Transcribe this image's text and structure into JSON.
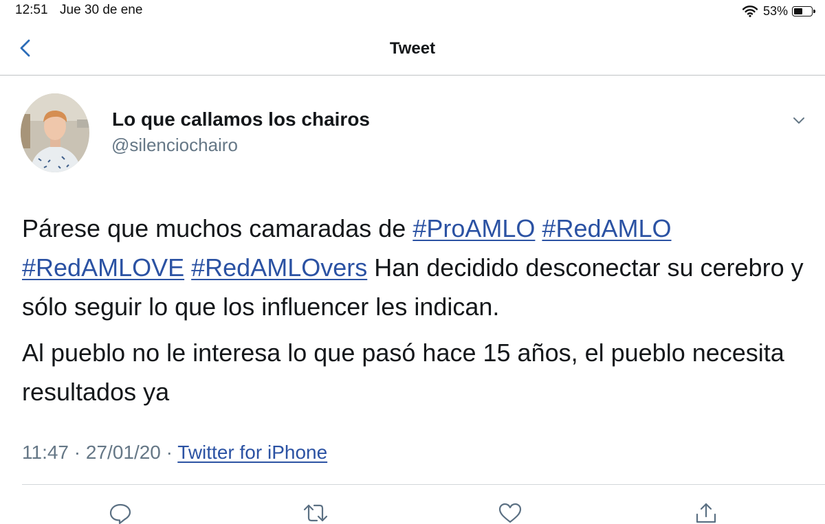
{
  "status_bar": {
    "time": "12:51",
    "date": "Jue 30 de ene",
    "battery_percent": "53%",
    "battery_level": 0.53,
    "icons": [
      "wifi-icon",
      "battery-icon"
    ]
  },
  "nav": {
    "title": "Tweet",
    "back_icon": "chevron-left-icon"
  },
  "tweet": {
    "author": {
      "display_name": "Lo que callamos los chairos",
      "username": "@silenciochairo"
    },
    "paragraphs": [
      [
        {
          "text": "Párese que muchos camaradas de ",
          "hashtag": false
        },
        {
          "text": "#ProAMLO",
          "hashtag": true
        },
        {
          "text": " ",
          "hashtag": false
        },
        {
          "text": "#RedAMLO",
          "hashtag": true
        },
        {
          "text": " ",
          "hashtag": false
        },
        {
          "text": "#RedAMLOVE",
          "hashtag": true
        },
        {
          "text": " ",
          "hashtag": false
        },
        {
          "text": "#RedAMLOvers",
          "hashtag": true
        },
        {
          "text": " Han decidido desconectar su cerebro y sólo seguir lo que los influencer les indican.",
          "hashtag": false
        }
      ],
      [
        {
          "text": "Al pueblo no le interesa lo que pasó hace 15 años, el pueblo necesita resultados ya",
          "hashtag": false
        }
      ]
    ],
    "meta": {
      "time": "11:47",
      "separator": " · ",
      "date": "27/01/20",
      "source": "Twitter for iPhone"
    }
  },
  "actions": [
    {
      "name": "reply",
      "icon": "comment-icon"
    },
    {
      "name": "retweet",
      "icon": "retweet-icon"
    },
    {
      "name": "like",
      "icon": "heart-icon"
    },
    {
      "name": "share",
      "icon": "share-icon"
    }
  ],
  "colors": {
    "link": "#2b52a3",
    "text": "#14171a",
    "secondary": "#657786",
    "icon": "#5b7083"
  }
}
